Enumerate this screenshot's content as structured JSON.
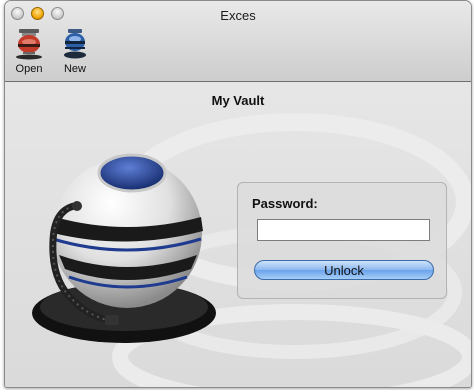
{
  "window": {
    "title": "Exces"
  },
  "toolbar": {
    "open": {
      "label": "Open",
      "icon": "red-vault-icon"
    },
    "new": {
      "label": "New",
      "icon": "blue-vault-icon"
    }
  },
  "main": {
    "vault_title": "My Vault",
    "password_label": "Password:",
    "password_value": "",
    "unlock_label": "Unlock"
  },
  "colors": {
    "accent": "#6aa2ea",
    "vault_blue": "#1f3b8f"
  }
}
